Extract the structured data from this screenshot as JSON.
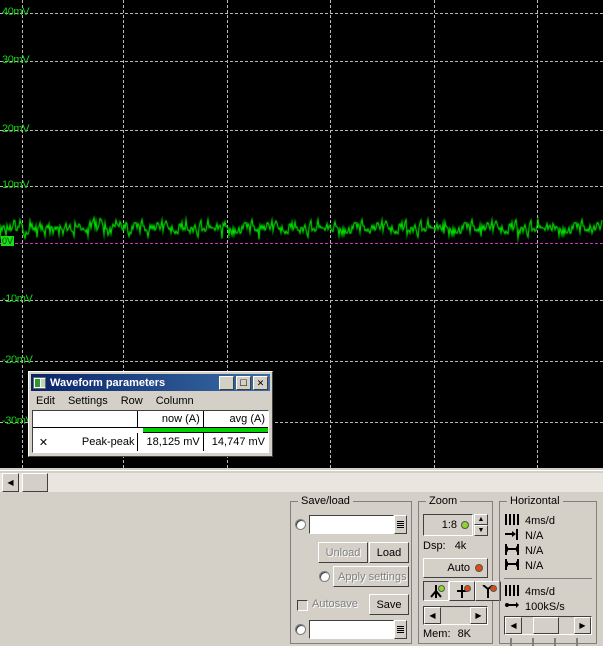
{
  "scope": {
    "y_axis_labels": [
      "40mV",
      "30mV",
      "20mV",
      "10mV",
      "-10mV",
      "-20mV",
      "-30mV"
    ],
    "zero_marker": "0V",
    "trace_color": "#00e000",
    "zero_line_color": "#cc33cc",
    "grid_color": "#b9b9b9",
    "background": "#000000"
  },
  "waveform_window": {
    "title": "Waveform parameters",
    "icon": "waveform-window-icon",
    "titlebar_buttons": {
      "minimize": "_",
      "maximize": "□",
      "close": "✕"
    },
    "menu": [
      "Edit",
      "Settings",
      "Row",
      "Column"
    ],
    "table": {
      "columns": [
        "",
        "now (A)",
        "avg (A)"
      ],
      "rows": [
        {
          "marker": "✕",
          "name": "Peak-peak",
          "now": "18,125 mV",
          "avg": "14,747 mV"
        }
      ]
    }
  },
  "save_load": {
    "title": "Save/load",
    "load_path_value": "",
    "unload_label": "Unload",
    "load_label": "Load",
    "apply_settings_label": "Apply settings",
    "autosave_label": "Autosave",
    "save_label": "Save",
    "save_path_value": ""
  },
  "zoom_panel": {
    "title": "Zoom",
    "ratio": "1:8",
    "dsp_label": "Dsp:",
    "dsp_value": "4k",
    "auto_label": "Auto",
    "mem_label": "Mem:",
    "mem_value": "8K",
    "trigger_buttons": [
      "trigger-mode-left",
      "trigger-mode-center",
      "trigger-mode-right"
    ]
  },
  "horizontal_panel": {
    "title": "Horizontal",
    "rows": [
      {
        "icon": "timebase-icon",
        "value": "4ms/d"
      },
      {
        "icon": "delay-icon",
        "value": "N/A"
      },
      {
        "icon": "span-icon",
        "value": "N/A"
      },
      {
        "icon": "span-icon",
        "value": "N/A"
      }
    ],
    "rows2": [
      {
        "icon": "timebase-icon",
        "value": "4ms/d"
      },
      {
        "icon": "samplerate-icon",
        "value": "100kS/s"
      }
    ]
  }
}
